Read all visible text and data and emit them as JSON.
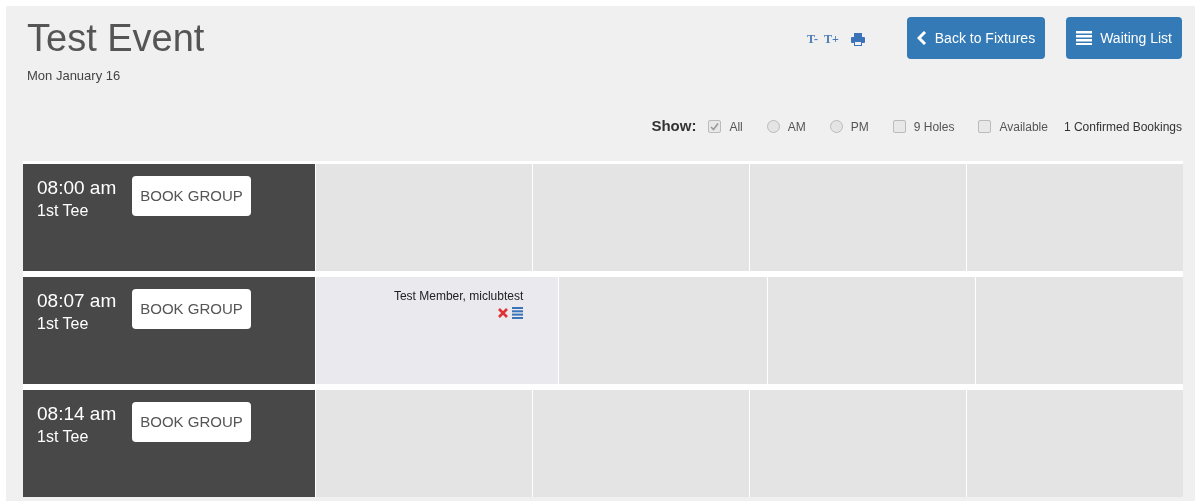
{
  "header": {
    "title": "Test Event",
    "date": "Mon January 16",
    "font_controls": [
      "T-",
      "T+"
    ],
    "buttons": [
      {
        "kind": "back",
        "label": "Back to Fixtures"
      },
      {
        "kind": "list",
        "label": "Waiting List"
      }
    ]
  },
  "filters": {
    "label": "Show:",
    "options": [
      {
        "kind": "checkbox",
        "label": "All",
        "checked": true
      },
      {
        "kind": "radio",
        "label": "AM",
        "checked": false
      },
      {
        "kind": "radio",
        "label": "PM",
        "checked": false
      },
      {
        "kind": "checkbox",
        "label": "9 Holes",
        "checked": false
      },
      {
        "kind": "checkbox",
        "label": "Available",
        "checked": false
      }
    ],
    "summary": "1 Confirmed Bookings"
  },
  "rows": [
    {
      "time": "08:00 am",
      "tee": "1st Tee",
      "button": "BOOK GROUP",
      "slots": [
        {
          "kind": "empty"
        },
        {
          "kind": "empty"
        },
        {
          "kind": "empty"
        },
        {
          "kind": "empty"
        }
      ]
    },
    {
      "time": "08:07 am",
      "tee": "1st Tee",
      "button": "BOOK GROUP",
      "slots": [
        {
          "kind": "booking",
          "name": "Test Member, miclubtest"
        },
        {
          "kind": "empty"
        },
        {
          "kind": "empty"
        },
        {
          "kind": "empty"
        }
      ]
    },
    {
      "time": "08:14 am",
      "tee": "1st Tee",
      "button": "BOOK GROUP",
      "slots": [
        {
          "kind": "empty"
        },
        {
          "kind": "empty"
        },
        {
          "kind": "empty"
        },
        {
          "kind": "empty"
        }
      ]
    }
  ]
}
